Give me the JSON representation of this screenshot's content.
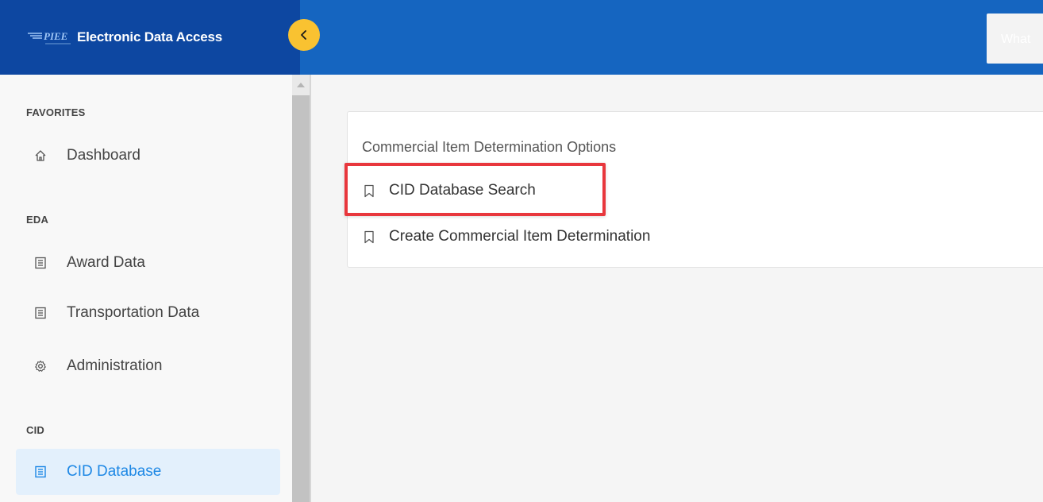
{
  "header": {
    "brand_logo_text": "PIEE",
    "app_title": "Electronic Data Access",
    "search_placeholder": "What"
  },
  "sidebar": {
    "sections": [
      {
        "header": "FAVORITES",
        "items": [
          {
            "label": "Dashboard",
            "icon": "home-icon"
          }
        ]
      },
      {
        "header": "EDA",
        "items": [
          {
            "label": "Award Data",
            "icon": "document-icon"
          },
          {
            "label": "Transportation Data",
            "icon": "document-icon"
          },
          {
            "label": "Administration",
            "icon": "gear-icon"
          }
        ]
      },
      {
        "header": "CID",
        "items": [
          {
            "label": "CID Database",
            "icon": "document-icon",
            "active": true
          }
        ]
      }
    ]
  },
  "main": {
    "card": {
      "title": "Commercial Item Determination Options",
      "options": [
        {
          "label": "CID Database Search",
          "icon": "bookmark-icon",
          "highlighted": true
        },
        {
          "label": "Create Commercial Item Determination",
          "icon": "bookmark-icon"
        }
      ]
    }
  },
  "colors": {
    "brand_bg": "#0d47a1",
    "topbar_bg": "#1565c0",
    "collapse_button": "#f9c231",
    "active_item_bg": "#e3f0fc",
    "active_item_text": "#1e88e5",
    "highlight_border": "#e8373d"
  }
}
